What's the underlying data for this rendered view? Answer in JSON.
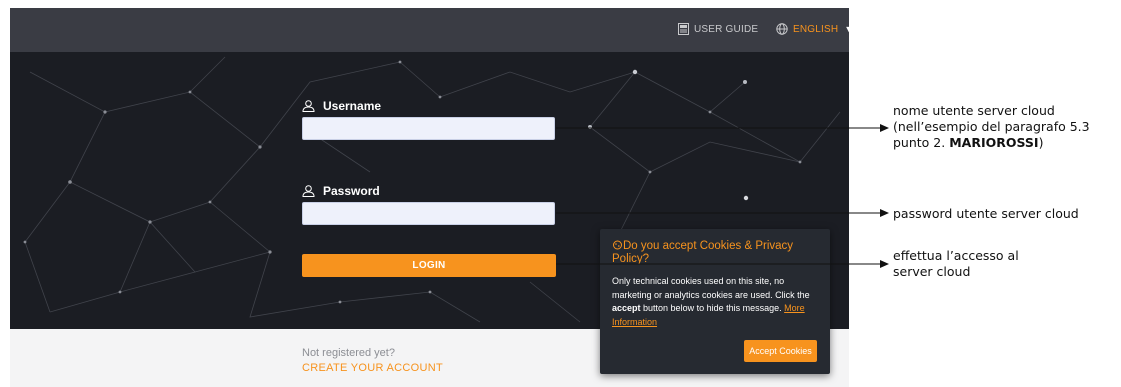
{
  "topbar": {
    "user_guide_label": "USER GUIDE",
    "user_guide_icon": "book-icon",
    "language_label": "ENGLISH",
    "language_icon": "globe-icon"
  },
  "login": {
    "username_label": "Username",
    "username_value": "",
    "password_label": "Password",
    "password_value": "",
    "login_button": "LOGIN"
  },
  "footer": {
    "not_registered": "Not registered yet?",
    "create_account": "CREATE YOUR ACCOUNT"
  },
  "cookie_banner": {
    "icon": "cookie-icon",
    "title": "Do you accept Cookies & Privacy Policy?",
    "body_part1": "Only technical cookies used on this site, no marketing or analytics cookies are used. Click the ",
    "body_bold": "accept",
    "body_part2": " button below to hide this message. ",
    "more_info_link": "More Information",
    "accept_button": "Accept Cookies"
  },
  "annotations": {
    "username_note_line1": "nome utente server cloud",
    "username_note_line2": "(nell’esempio del paragrafo 5.3",
    "username_note_line3_prefix": "punto 2. ",
    "username_note_line3_bold": "MARIOROSSI",
    "username_note_line3_suffix": ")",
    "password_note": "password utente server cloud",
    "login_note_line1": "effettua l’accesso al",
    "login_note_line2": "server cloud"
  },
  "colors": {
    "accent": "#f7931e",
    "background_dark": "#1b1d23",
    "topbar": "#3a3c44",
    "input_bg": "#eef1fb"
  }
}
